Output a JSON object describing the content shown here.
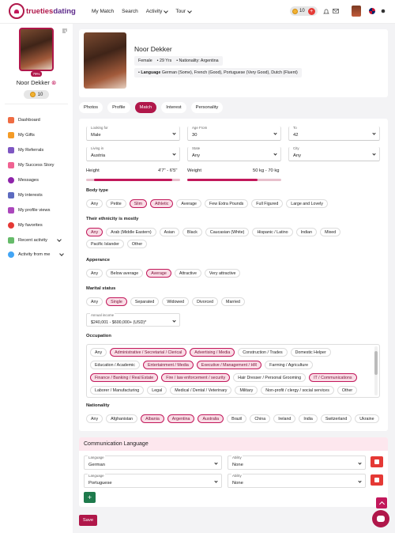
{
  "brand": {
    "name_a": "trueties",
    "name_b": "dating"
  },
  "nav": {
    "items": [
      "My Match",
      "Search",
      "Activity",
      "Tour"
    ],
    "coins": "10"
  },
  "sidebar": {
    "badge": "79%",
    "name": "Noor Dekker",
    "coins": "10",
    "menu": [
      "Dashboard",
      "My Gifts",
      "My Referrals",
      "My Success Story",
      "Messages",
      "My interests",
      "My profile views",
      "My favorites",
      "Recent activity",
      "Activity from me"
    ]
  },
  "profile": {
    "name": "Noor Dekker",
    "gender": "Female",
    "age": "29 Yrs",
    "nationality": "Nationality: Argentina",
    "language_label": "Language",
    "languages": "German (Some), French (Good), Portuguese (Very Good), Dutch (Fluent)"
  },
  "tabs": [
    "Photos",
    "Profile",
    "Match",
    "Interest",
    "Personality"
  ],
  "filters": {
    "looking_for": {
      "label": "Looking for",
      "value": "Male"
    },
    "age_from": {
      "label": "Age From",
      "value": "30"
    },
    "to": {
      "label": "To",
      "value": "42"
    },
    "living_in": {
      "label": "Living in",
      "value": "Austria"
    },
    "state": {
      "label": "State",
      "value": "Any"
    },
    "city": {
      "label": "City",
      "value": "Any"
    },
    "height": {
      "label": "Height",
      "value": "4'7\" - 6'5\"",
      "range": [
        0.08,
        0.92
      ]
    },
    "weight": {
      "label": "Weight",
      "value": "50 kg - 70 kg",
      "range": [
        0.0,
        0.75
      ]
    },
    "annual_income": {
      "label": "Annual income",
      "value": "$240,001 - $600,000+ (USD)*"
    }
  },
  "sections": {
    "body": {
      "title": "Body type",
      "options": [
        "Any",
        "Petite",
        "Slim",
        "Athletic",
        "Average",
        "Few Extra Pounds",
        "Full Figured",
        "Large and Lovely"
      ],
      "selected": [
        2,
        3
      ]
    },
    "ethnicity": {
      "title": "Their ethnicity is mostly",
      "options": [
        "Any",
        "Arab (Middle Eastern)",
        "Asian",
        "Black",
        "Caucasian (White)",
        "Hispanic / Latino",
        "Indian",
        "Mixed",
        "Pacific Islander",
        "Other"
      ],
      "selected": [
        0
      ]
    },
    "appearance": {
      "title": "Apperance",
      "options": [
        "Any",
        "Below average",
        "Average",
        "Attractive",
        "Very attractive"
      ],
      "selected": [
        2
      ]
    },
    "marital": {
      "title": "Marital status",
      "options": [
        "Any",
        "Single",
        "Separated",
        "Widowed",
        "Divorced",
        "Married"
      ],
      "selected": [
        1
      ]
    },
    "occupation": {
      "title": "Occupation",
      "options": [
        "Any",
        "Administrative / Secretarial / Clerical",
        "Advertising / Media",
        "Construction / Trades",
        "Domestic Helper",
        "Education / Academic",
        "Entertainment / Media",
        "Executive / Management / HR",
        "Farming / Agriculture",
        "Finance / Banking / Real Estate",
        "Fire / law enforcement / security",
        "Hair Dresser / Personal Grooming",
        "IT / Communications",
        "Laborer / Manufacturing",
        "Legal",
        "Medical / Dental / Veterinary",
        "Military",
        "Non-profit / clergy / social services",
        "Other"
      ],
      "selected": [
        1,
        2,
        6,
        7,
        9,
        10,
        12
      ]
    },
    "nationality": {
      "title": "Nationality",
      "options": [
        "Any",
        "Afghanistan",
        "Albania",
        "Argentina",
        "Australia",
        "Brazil",
        "China",
        "Ireland",
        "India",
        "Switzerland",
        "Ukraine"
      ],
      "selected": [
        2,
        3,
        4
      ]
    }
  },
  "communication": {
    "title": "Communication Language",
    "rows": [
      {
        "lang_label": "Language",
        "lang": "German",
        "ability_label": "Ability",
        "ability": "None"
      },
      {
        "lang_label": "Language",
        "lang": "Portuguese",
        "ability_label": "Ability",
        "ability": "None"
      }
    ],
    "add": "+"
  },
  "save": "Save",
  "colors": {
    "accent": "#b0174a",
    "chip_selected": "#f9dde6",
    "delete": "#e53935",
    "add": "#1e7a4c"
  }
}
